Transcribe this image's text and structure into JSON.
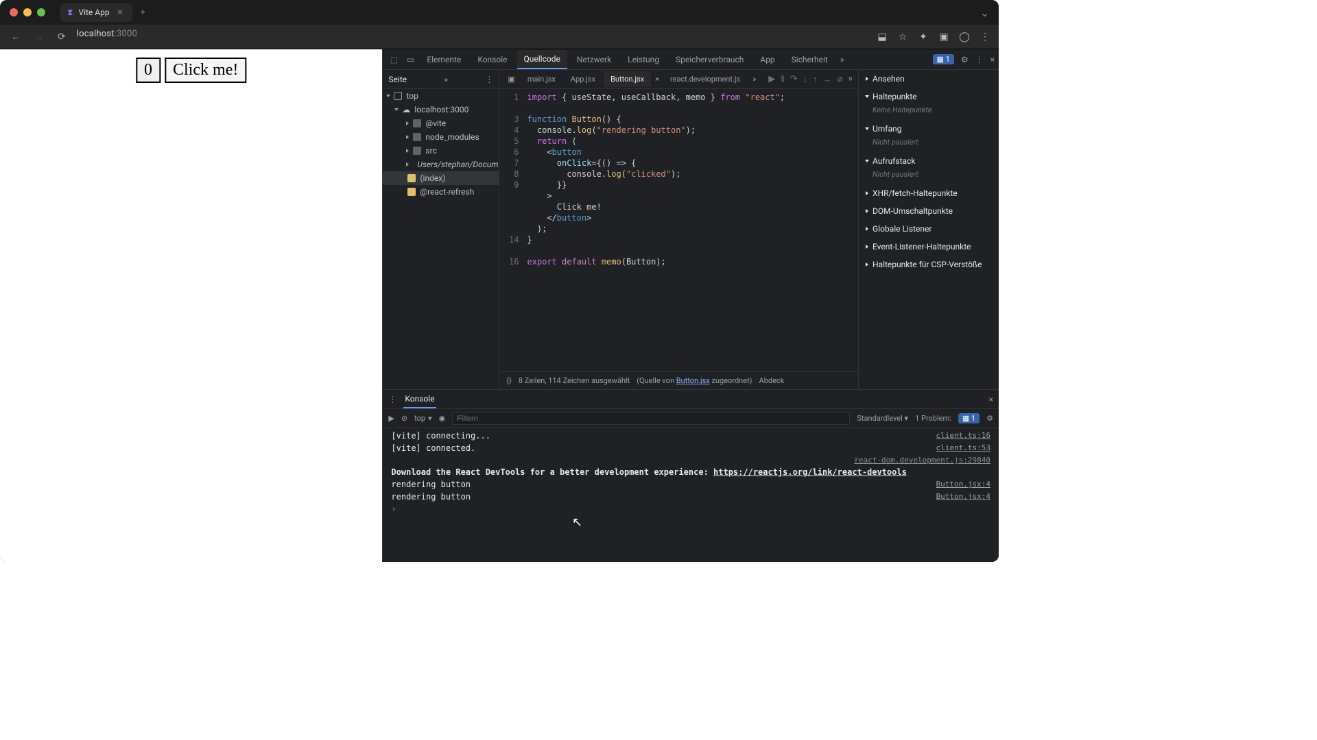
{
  "browser": {
    "tab_title": "Vite App",
    "url_host": "localhost",
    "url_port": ":3000"
  },
  "page": {
    "counter": "0",
    "button_label": "Click me!"
  },
  "devtools": {
    "tabs": [
      "Elemente",
      "Konsole",
      "Quellcode",
      "Netzwerk",
      "Leistung",
      "Speicherverbrauch",
      "App",
      "Sicherheit"
    ],
    "active_tab": "Quellcode",
    "issues_count": "1",
    "left_tab": "Seite",
    "tree": {
      "top": "top",
      "host": "localhost:3000",
      "folders": [
        "@vite",
        "node_modules",
        "src",
        "Users/stephan/Docum…"
      ],
      "index": "(index)",
      "react_refresh": "@react-refresh"
    },
    "editor_tabs": [
      "main.jsx",
      "App.jsx",
      "Button.jsx",
      "react.development.js"
    ],
    "editor_active": "Button.jsx",
    "code_lines": [
      {
        "n": "1",
        "h": "<span class=kw>import</span> { useState, useCallback, memo } <span class=kw>from</span> <span class=str>\"react\"</span>;"
      },
      {
        "n": "",
        "h": ""
      },
      {
        "n": "3",
        "h": "<span class=fn>function</span> <span class=id>Button</span>() {"
      },
      {
        "n": "4",
        "h": "  console.<span class=id>log</span>(<span class=str>\"rendering button\"</span>);"
      },
      {
        "n": "5",
        "h": "  <span class=kw>return</span> ("
      },
      {
        "n": "6",
        "h": "    &lt;<span class=tag>button</span>"
      },
      {
        "n": "7",
        "h": "      <span class=attr>onClick</span>={() =&gt; {"
      },
      {
        "n": "8",
        "h": "        console.<span class=id>log</span>(<span class=str>\"clicked\"</span>);"
      },
      {
        "n": "9",
        "h": "      }}"
      },
      {
        "n": "",
        "h": "    &gt;"
      },
      {
        "n": "",
        "h": "      Click me!"
      },
      {
        "n": "",
        "h": "    &lt;/<span class=tag>button</span>&gt;"
      },
      {
        "n": "",
        "h": "  );"
      },
      {
        "n": "14",
        "h": "}"
      },
      {
        "n": "",
        "h": ""
      },
      {
        "n": "16",
        "h": "<span class=kw>export</span> <span class=kw2>default</span> <span class=id>memo</span>(Button);"
      },
      {
        "n": "",
        "h": ""
      }
    ],
    "status_bar": {
      "lines_chars": "8 Zeilen, 114 Zeichen ausgewählt",
      "source_of": "(Quelle von",
      "source_file": "Button.jsx",
      "source_tail": "zugeordnet)",
      "coverage": "Abdeck"
    },
    "dbg": {
      "ansehen": "Ansehen",
      "haltepunkte": "Haltepunkte",
      "haltepunkte_note": "Keine Haltepunkte",
      "umfang": "Umfang",
      "umfang_note": "Nicht pausiert",
      "aufrufstack": "Aufrufstack",
      "aufrufstack_note": "Nicht pausiert",
      "xhr": "XHR/fetch-Haltepunkte",
      "dom": "DOM-Umschaltpunkte",
      "globale": "Globale Listener",
      "evl": "Event-Listener-Haltepunkte",
      "csp": "Haltepunkte für CSP-Verstöße"
    },
    "drawer": {
      "title": "Konsole",
      "context": "top",
      "filter_placeholder": "Filtern",
      "level": "Standardlevel",
      "problems_label": "1 Problem:",
      "problems_count": "1",
      "rows": [
        {
          "msg": "[vite] connecting...",
          "src": "client.ts:16"
        },
        {
          "msg": "[vite] connected.",
          "src": "client.ts:53"
        },
        {
          "msg": "",
          "src": "react-dom.development.js:29840",
          "dim": true
        },
        {
          "msg": "Download the React DevTools for a better development experience:",
          "url": "https://reactjs.org/link/react-devtools",
          "bold": true
        },
        {
          "msg": "rendering button",
          "src": "Button.jsx:4"
        },
        {
          "msg": "rendering button",
          "src": "Button.jsx:4"
        }
      ]
    }
  }
}
